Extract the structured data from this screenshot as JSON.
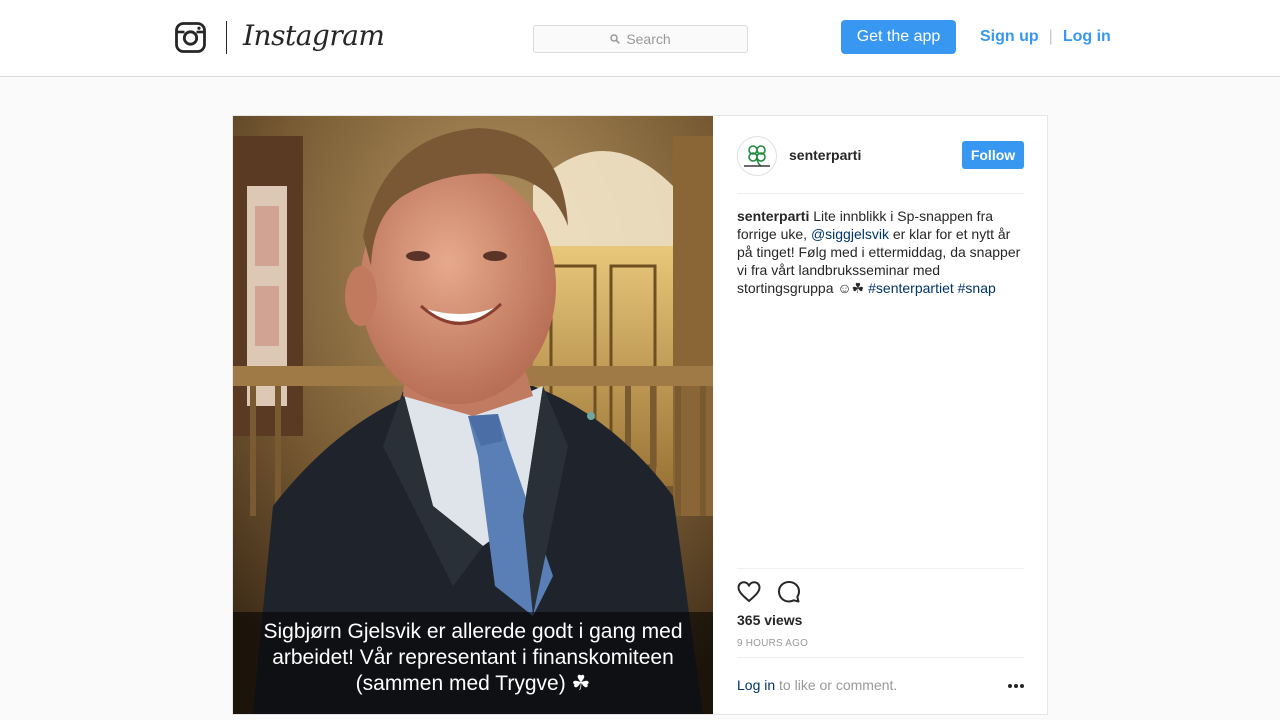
{
  "header": {
    "wordmark": "Instagram",
    "search_placeholder": "Search",
    "get_app_label": "Get the app",
    "signup_label": "Sign up",
    "separator": "|",
    "login_label": "Log in"
  },
  "post": {
    "owner": {
      "username": "senterparti",
      "follow_label": "Follow"
    },
    "caption": {
      "username": "senterparti",
      "text_1": " Lite innblikk i Sp-snappen fra forrige uke, ",
      "mention": "@siggjelsvik",
      "text_2": " er klar for et nytt år på tinget! Følg med i ettermiddag, da snapper vi fra vårt landbruksseminar med stortingsgruppa ☺☘ ",
      "hashtag_1": "#senterpartiet",
      "hashtag_2": "#snap"
    },
    "media_text": {
      "line_1": "Sigbjørn Gjelsvik er allerede godt i gang med",
      "line_2": "arbeidet! Vår representant i finanskomiteen",
      "line_3": "(sammen med Trygve) ☘"
    },
    "views": "365 views",
    "age": "9 HOURS AGO",
    "comment": {
      "login_label": "Log in",
      "suffix": " to like or comment."
    }
  },
  "colors": {
    "accent": "#3897f0",
    "link": "#003569",
    "muted": "#999999",
    "border": "#dbdbdb",
    "background": "#fafafa"
  },
  "icons": {
    "brand": "instagram-glyph-icon",
    "search": "search-icon",
    "like": "heart-icon",
    "comment": "comment-bubble-icon",
    "more": "more-options-icon"
  }
}
